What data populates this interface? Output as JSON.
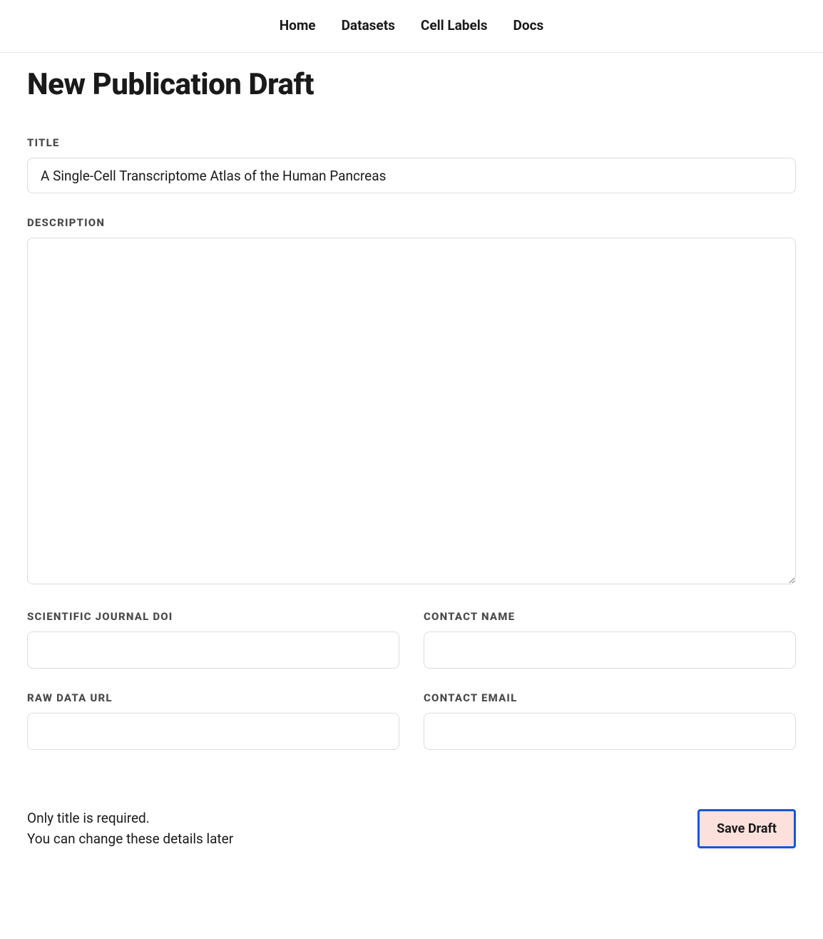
{
  "nav": {
    "home": "Home",
    "datasets": "Datasets",
    "cell_labels": "Cell Labels",
    "docs": "Docs"
  },
  "page": {
    "title": "New Publication Draft"
  },
  "form": {
    "title_label": "TITLE",
    "title_value": "A Single-Cell Transcriptome Atlas of the Human Pancreas",
    "description_label": "DESCRIPTION",
    "description_value": "",
    "doi_label": "SCIENTIFIC JOURNAL DOI",
    "doi_value": "",
    "contact_name_label": "CONTACT NAME",
    "contact_name_value": "",
    "raw_data_url_label": "RAW DATA URL",
    "raw_data_url_value": "",
    "contact_email_label": "CONTACT EMAIL",
    "contact_email_value": ""
  },
  "footer": {
    "line1": "Only title is required.",
    "line2": "You can change these details later",
    "save_label": "Save Draft"
  }
}
